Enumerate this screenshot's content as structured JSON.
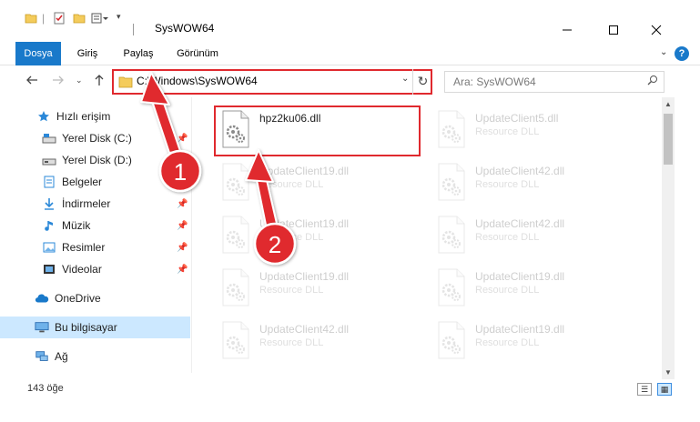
{
  "window": {
    "title": "SysWOW64"
  },
  "ribbon": {
    "tabs": [
      "Dosya",
      "Giriş",
      "Paylaş",
      "Görünüm"
    ],
    "help": "?"
  },
  "navbar": {
    "address": "C:\\Windows\\SysWOW64",
    "search_placeholder": "Ara: SysWOW64"
  },
  "sidebar": {
    "items": [
      {
        "label": "Hızlı erişim",
        "icon": "star-icon",
        "pinned": false
      },
      {
        "label": "Yerel Disk (C:)",
        "icon": "drive-icon",
        "pinned": true
      },
      {
        "label": "Yerel Disk (D:)",
        "icon": "drive-icon",
        "pinned": false
      },
      {
        "label": "Belgeler",
        "icon": "document-icon",
        "pinned": true
      },
      {
        "label": "İndirmeler",
        "icon": "download-icon",
        "pinned": true
      },
      {
        "label": "Müzik",
        "icon": "music-icon",
        "pinned": true
      },
      {
        "label": "Resimler",
        "icon": "pictures-icon",
        "pinned": true
      },
      {
        "label": "Videolar",
        "icon": "video-icon",
        "pinned": true
      },
      {
        "label": "OneDrive",
        "icon": "cloud-icon",
        "pinned": false
      },
      {
        "label": "Bu bilgisayar",
        "icon": "computer-icon",
        "pinned": false,
        "selected": true
      },
      {
        "label": "Ağ",
        "icon": "network-icon",
        "pinned": false
      }
    ]
  },
  "files": {
    "col1": [
      {
        "name": "hpz2ku06.dll",
        "type": "",
        "highlighted": true
      },
      {
        "name": "UpdateClient19.dll",
        "type": "Resource DLL"
      },
      {
        "name": "UpdateClient19.dll",
        "type": "Resource DLL"
      },
      {
        "name": "UpdateClient19.dll",
        "type": "Resource DLL"
      },
      {
        "name": "UpdateClient42.dll",
        "type": "Resource DLL"
      }
    ],
    "col2": [
      {
        "name": "UpdateClient5.dll",
        "type": "Resource DLL"
      },
      {
        "name": "UpdateClient42.dll",
        "type": "Resource DLL"
      },
      {
        "name": "UpdateClient42.dll",
        "type": "Resource DLL"
      },
      {
        "name": "UpdateClient19.dll",
        "type": "Resource DLL"
      },
      {
        "name": "UpdateClient19.dll",
        "type": "Resource DLL"
      }
    ]
  },
  "status": {
    "item_count": "143 öğe"
  },
  "annotations": {
    "step1": "1",
    "step2": "2",
    "color": "#e0292e"
  }
}
